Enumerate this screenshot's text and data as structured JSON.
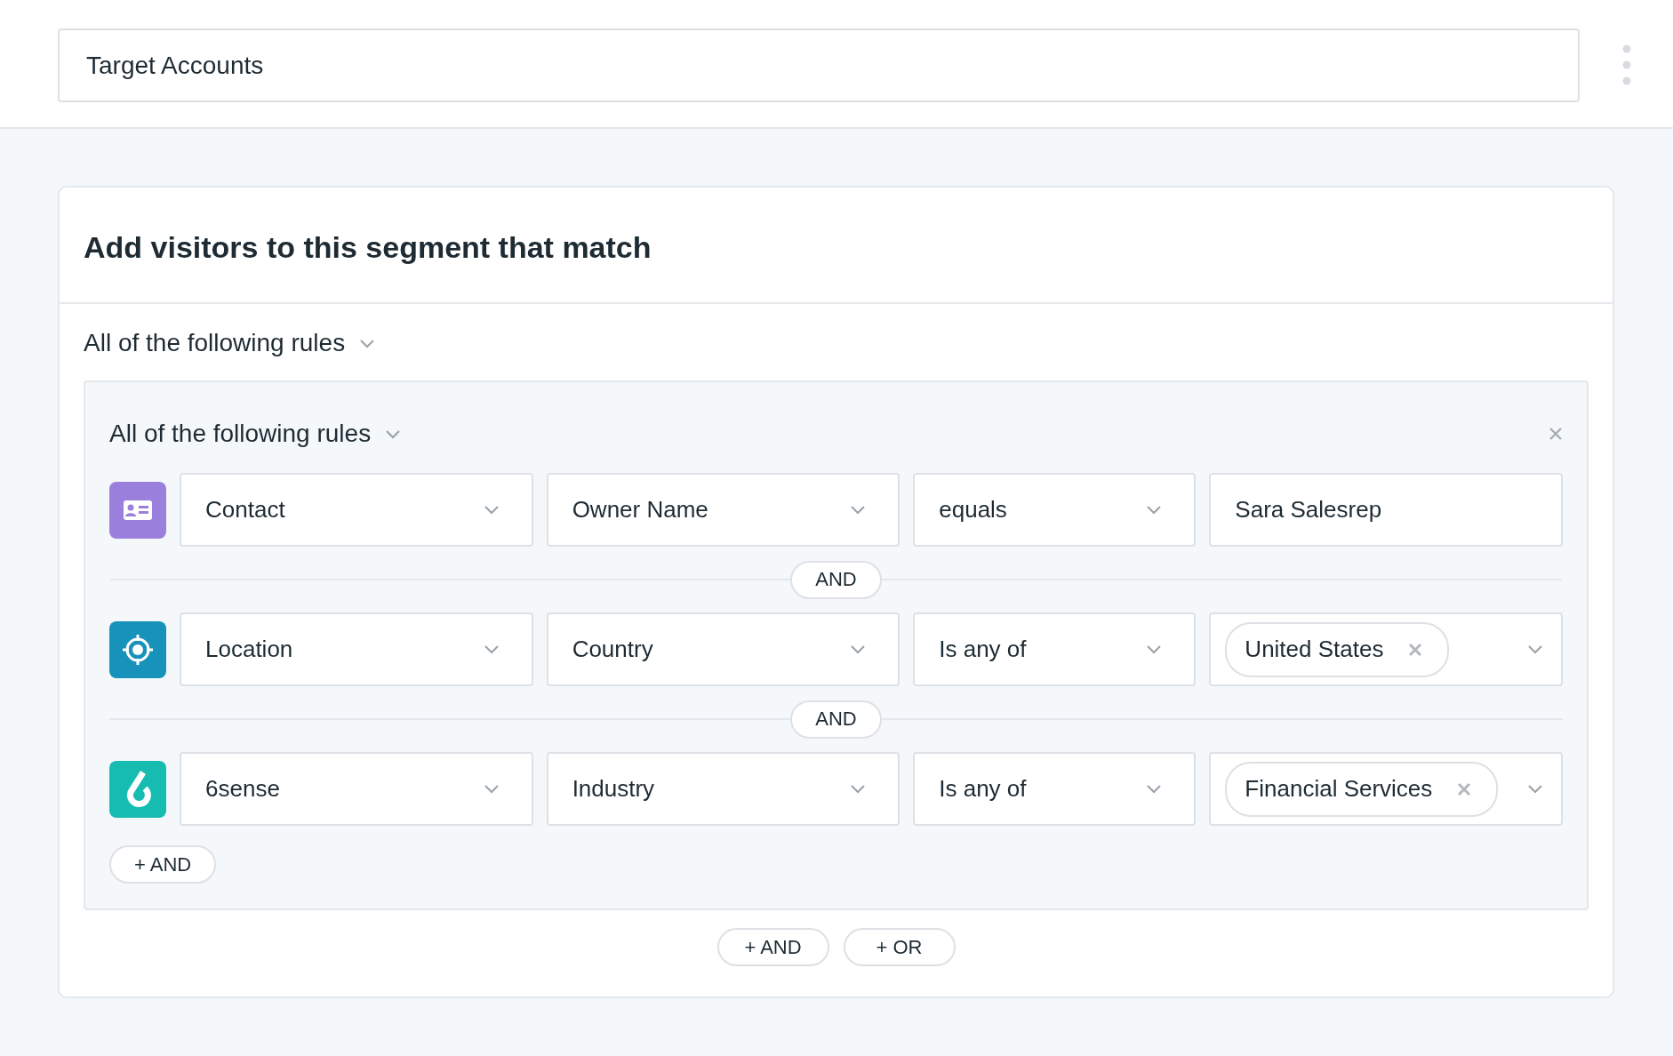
{
  "segment_name": {
    "value": "Target Accounts"
  },
  "card": {
    "title": "Add visitors to this segment that match",
    "match_mode": "All of the following rules",
    "group": {
      "match_mode": "All of the following rules",
      "rules": [
        {
          "kind": "contact",
          "fields": [
            {
              "kind": "select",
              "value": "Contact"
            },
            {
              "kind": "select",
              "value": "Owner Name"
            },
            {
              "kind": "select",
              "value": "equals"
            },
            {
              "kind": "text",
              "value": "Sara Salesrep"
            }
          ]
        },
        {
          "kind": "location",
          "fields": [
            {
              "kind": "select",
              "value": "Location"
            },
            {
              "kind": "select",
              "value": "Country"
            },
            {
              "kind": "select",
              "value": "Is any of"
            },
            {
              "kind": "tags",
              "tags": [
                "United States"
              ]
            }
          ]
        },
        {
          "kind": "sixsense",
          "fields": [
            {
              "kind": "select",
              "value": "6sense"
            },
            {
              "kind": "select",
              "value": "Industry"
            },
            {
              "kind": "select",
              "value": "Is any of"
            },
            {
              "kind": "tags",
              "tags": [
                "Financial Services"
              ]
            }
          ]
        }
      ],
      "connectors": [
        "AND",
        "AND"
      ],
      "add_button": "+ AND"
    },
    "buttons": [
      "+ AND",
      "+ OR"
    ]
  }
}
